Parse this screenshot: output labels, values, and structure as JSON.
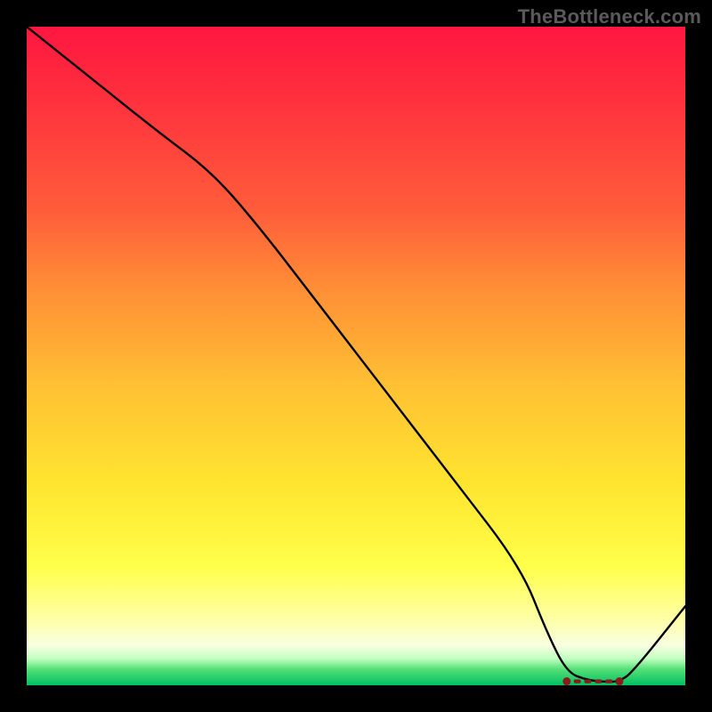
{
  "watermark": "TheBottleneck.com",
  "chart_data": {
    "type": "line",
    "title": "",
    "xlabel": "",
    "ylabel": "",
    "xlim": [
      0,
      100
    ],
    "ylim": [
      0,
      100
    ],
    "series": [
      {
        "name": "curve",
        "x": [
          0,
          10,
          20,
          28,
          35,
          45,
          55,
          65,
          75,
          79,
          82,
          85,
          88,
          90,
          92,
          100
        ],
        "values": [
          100,
          92,
          84,
          78,
          70,
          57,
          44,
          31,
          18,
          8,
          2,
          0.8,
          0.5,
          0.6,
          2,
          12
        ]
      }
    ],
    "marker_band": {
      "x_start": 82,
      "x_end": 90,
      "y": 0.6
    }
  }
}
